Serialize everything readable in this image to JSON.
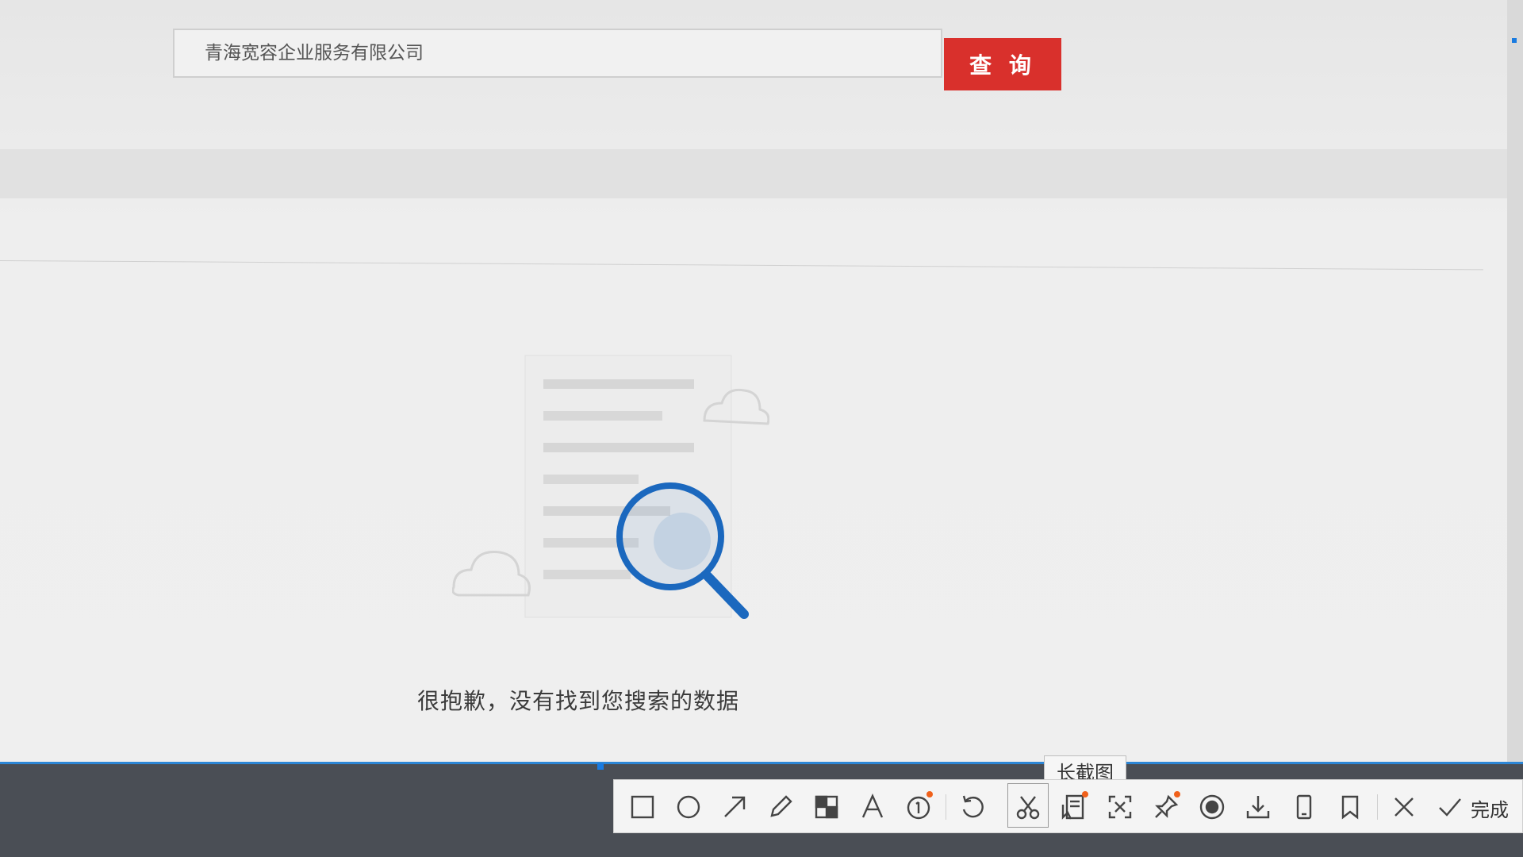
{
  "search": {
    "value": "青海宽容企业服务有限公司",
    "button_label": "查 询"
  },
  "empty_state": {
    "message": "很抱歉，没有找到您搜索的数据"
  },
  "screenshot_toolbar": {
    "tooltip": "长截图",
    "done_label": "完成",
    "tools": [
      {
        "icon": "rectangle-icon"
      },
      {
        "icon": "ellipse-icon"
      },
      {
        "icon": "arrow-icon"
      },
      {
        "icon": "pencil-icon"
      },
      {
        "icon": "mosaic-icon"
      },
      {
        "icon": "text-icon"
      },
      {
        "icon": "number-marker-icon"
      },
      {
        "icon": "undo-icon"
      },
      {
        "icon": "scissors-icon"
      },
      {
        "icon": "long-screenshot-icon"
      },
      {
        "icon": "ocr-expand-icon"
      },
      {
        "icon": "pin-icon"
      },
      {
        "icon": "record-icon"
      },
      {
        "icon": "download-icon"
      },
      {
        "icon": "phone-icon"
      },
      {
        "icon": "bookmark-icon"
      },
      {
        "icon": "close-icon"
      },
      {
        "icon": "check-icon"
      }
    ],
    "colors": {
      "accent": "#2c86d6",
      "badge": "#f0611b",
      "button": "#d9302c"
    }
  }
}
